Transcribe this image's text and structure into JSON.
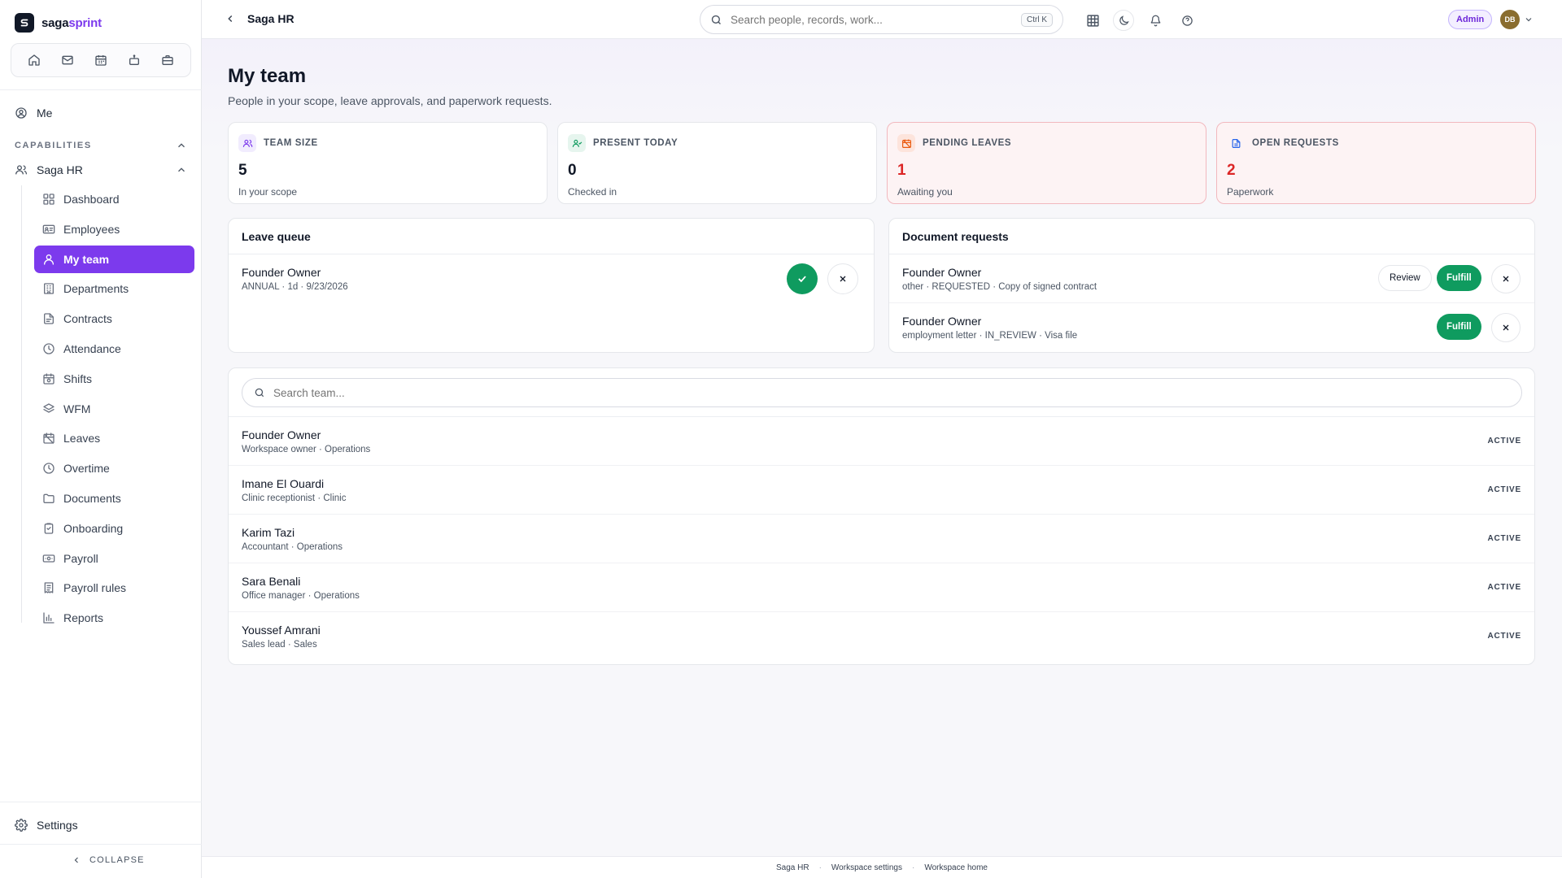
{
  "brand": {
    "name_part1": "saga",
    "name_part2": "sprint",
    "logo_letter": "S"
  },
  "quick_icons": [
    "home-icon",
    "mail-icon",
    "calendar-icon",
    "robot-icon",
    "briefcase-icon"
  ],
  "sidebar": {
    "me_label": "Me",
    "capabilities_label": "CAPABILITIES",
    "group_label": "Saga HR",
    "items": [
      {
        "label": "Dashboard",
        "icon": "dashboard-icon"
      },
      {
        "label": "Employees",
        "icon": "id-card-icon"
      },
      {
        "label": "My team",
        "icon": "user-icon",
        "active": true
      },
      {
        "label": "Departments",
        "icon": "building-icon"
      },
      {
        "label": "Contracts",
        "icon": "file-icon"
      },
      {
        "label": "Attendance",
        "icon": "clock-icon"
      },
      {
        "label": "Shifts",
        "icon": "calendar-clock-icon"
      },
      {
        "label": "WFM",
        "icon": "layers-icon"
      },
      {
        "label": "Leaves",
        "icon": "calendar-off-icon"
      },
      {
        "label": "Overtime",
        "icon": "clock-icon"
      },
      {
        "label": "Documents",
        "icon": "folder-icon"
      },
      {
        "label": "Onboarding",
        "icon": "clipboard-icon"
      },
      {
        "label": "Payroll",
        "icon": "banknote-icon"
      },
      {
        "label": "Payroll rules",
        "icon": "receipt-icon"
      },
      {
        "label": "Reports",
        "icon": "bar-chart-icon"
      }
    ],
    "settings_label": "Settings",
    "collapse_label": "COLLAPSE"
  },
  "topbar": {
    "title": "Saga HR",
    "search_placeholder": "Search people, records, work...",
    "search_shortcut": "Ctrl K",
    "role_badge": "Admin",
    "avatar_initials": "DB"
  },
  "page": {
    "title": "My team",
    "subtitle": "People in your scope, leave approvals, and paperwork requests."
  },
  "stats": [
    {
      "label": "TEAM SIZE",
      "value": "5",
      "caption": "In your scope",
      "icon": "users-icon"
    },
    {
      "label": "PRESENT TODAY",
      "value": "0",
      "caption": "Checked in",
      "icon": "user-check-icon"
    },
    {
      "label": "PENDING LEAVES",
      "value": "1",
      "caption": "Awaiting you",
      "icon": "calendar-off-icon"
    },
    {
      "label": "OPEN REQUESTS",
      "value": "2",
      "caption": "Paperwork",
      "icon": "file-text-icon"
    }
  ],
  "leave_queue": {
    "title": "Leave queue",
    "items": [
      {
        "name": "Founder Owner",
        "meta": "ANNUAL · 1d · 9/23/2026"
      }
    ]
  },
  "document_requests": {
    "title": "Document requests",
    "review_label": "Review",
    "fulfill_label": "Fulfill",
    "items": [
      {
        "name": "Founder Owner",
        "meta": "other · REQUESTED · Copy of signed contract"
      },
      {
        "name": "Founder Owner",
        "meta": "employment letter · IN_REVIEW · Visa file"
      }
    ]
  },
  "team": {
    "search_placeholder": "Search team...",
    "members": [
      {
        "name": "Founder Owner",
        "meta": "Workspace owner · Operations",
        "status": "ACTIVE"
      },
      {
        "name": "Imane El Ouardi",
        "meta": "Clinic receptionist · Clinic",
        "status": "ACTIVE"
      },
      {
        "name": "Karim Tazi",
        "meta": "Accountant · Operations",
        "status": "ACTIVE"
      },
      {
        "name": "Sara Benali",
        "meta": "Office manager · Operations",
        "status": "ACTIVE"
      },
      {
        "name": "Youssef Amrani",
        "meta": "Sales lead · Sales",
        "status": "ACTIVE"
      }
    ]
  },
  "footer": {
    "links": [
      "Saga HR",
      "Workspace settings",
      "Workspace home"
    ]
  },
  "colors": {
    "accent": "#7c3aed",
    "success": "#0f9b5f",
    "alert": "#dc2626"
  }
}
